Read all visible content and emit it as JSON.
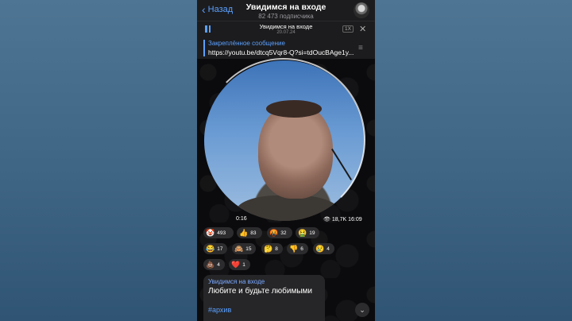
{
  "header": {
    "back_label": "Назад",
    "title": "Увидимся на входе",
    "subscribers": "82 473 подписчика"
  },
  "player": {
    "track_title": "Увидимся на входе",
    "track_date": "20.07.24",
    "speed_label": "1X"
  },
  "pinned": {
    "label": "Закреплённое сообщение",
    "text": "https://youtu.be/dtcq5Vqr8-Q?si=tdOucBAge1y..."
  },
  "video": {
    "elapsed": "0:16",
    "meta": "18,7K 16:09"
  },
  "reactions": [
    {
      "emoji": "🤡",
      "count": "493"
    },
    {
      "emoji": "👍",
      "count": "83"
    },
    {
      "emoji": "🤬",
      "count": "32"
    },
    {
      "emoji": "🤮",
      "count": "19"
    },
    {
      "emoji": "😂",
      "count": "17"
    },
    {
      "emoji": "🙈",
      "count": "15"
    },
    {
      "emoji": "🤔",
      "count": "8"
    },
    {
      "emoji": "👎",
      "count": "6"
    },
    {
      "emoji": "😢",
      "count": "4"
    },
    {
      "emoji": "💩",
      "count": "4"
    },
    {
      "emoji": "❤️",
      "count": "1"
    }
  ],
  "message": {
    "author": "Увидимся на входе",
    "text": "Любите и будьте любимыми",
    "hashtag": "#архив"
  },
  "colors": {
    "accent": "#5aa0ff",
    "background": "#4f7594"
  }
}
